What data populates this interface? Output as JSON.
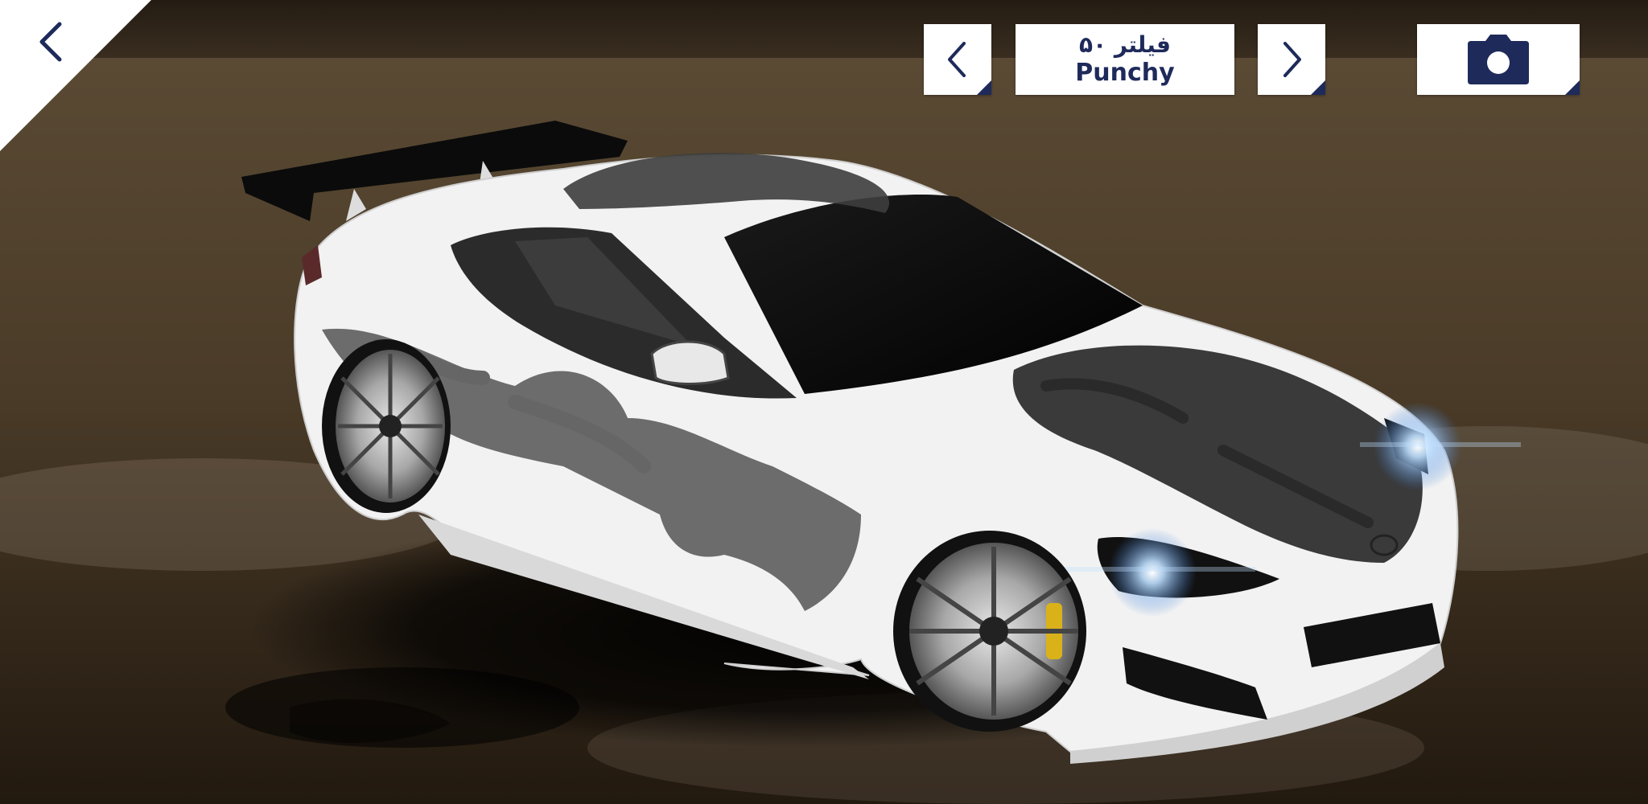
{
  "filter": {
    "name_fa": "فیلتر ۵۰",
    "name_en": "Punchy"
  },
  "icons": {
    "back": "chevron-left-icon",
    "prev": "chevron-left-icon",
    "next": "chevron-right-icon",
    "camera": "camera-icon"
  },
  "colors": {
    "accent": "#1e2a5a",
    "button_bg": "#ffffff",
    "car_body": "#f2f2f2",
    "decal": "#3d3d3d",
    "headlight_glow": "#bfe0ff"
  }
}
